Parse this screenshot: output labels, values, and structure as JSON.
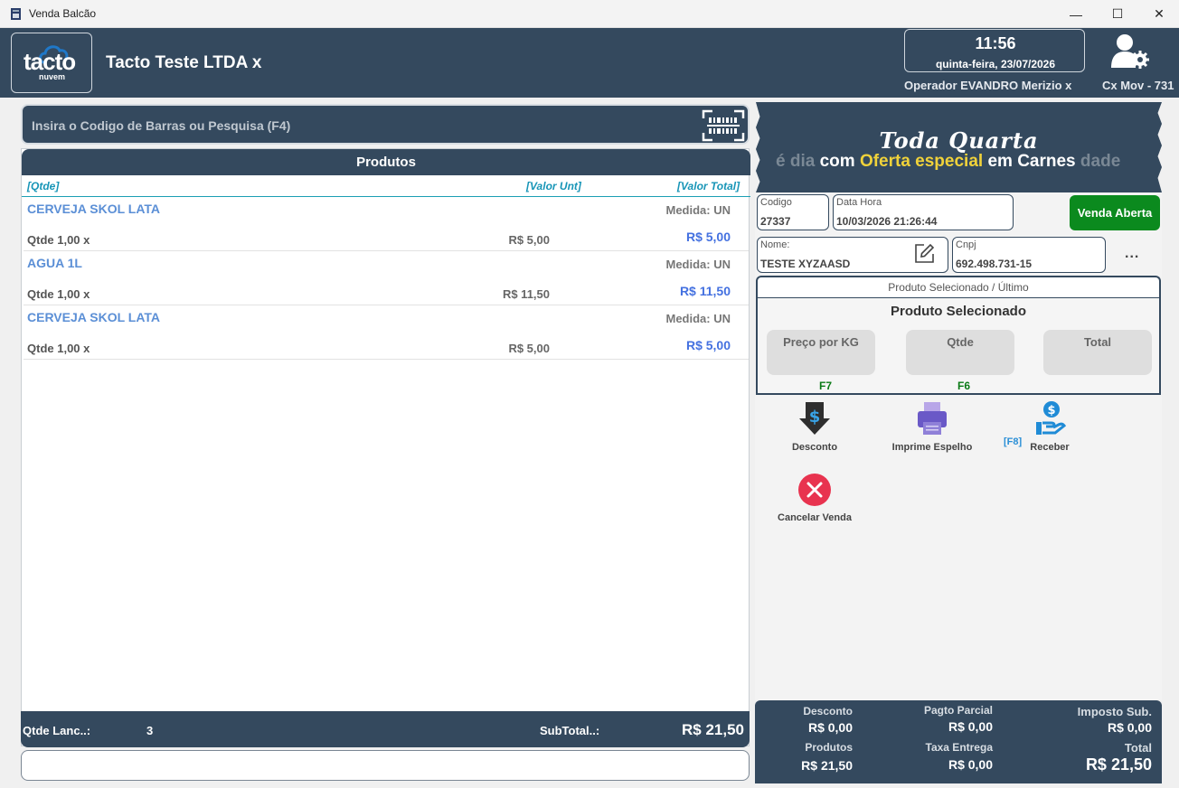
{
  "window": {
    "title": "Venda Balcão",
    "controls": {
      "minimize": "—",
      "maximize": "☐",
      "close": "✕"
    }
  },
  "header": {
    "logo_word": "tacto",
    "logo_sub": "nuvem",
    "company": "Tacto Teste LTDA x",
    "time": "11:56",
    "date": "quinta-feira, 23/07/2026",
    "operator": "Operador EVANDRO Merizio x",
    "cx_mov": "Cx Mov - 731"
  },
  "search": {
    "placeholder": "Insira o Codigo de Barras ou Pesquisa (F4)"
  },
  "products": {
    "title": "Produtos",
    "columns": {
      "qtde": "[Qtde]",
      "valor_unit": "[Valor Unt]",
      "valor_total": "[Valor Total]"
    },
    "items": [
      {
        "name": "CERVEJA  SKOL LATA",
        "medida": "Medida: UN",
        "qtde": "Qtde 1,00 x",
        "unit": "R$ 5,00",
        "total": "R$ 5,00"
      },
      {
        "name": "AGUA 1L",
        "medida": "Medida: UN",
        "qtde": "Qtde 1,00 x",
        "unit": "R$ 11,50",
        "total": "R$ 11,50"
      },
      {
        "name": "CERVEJA  SKOL LATA",
        "medida": "Medida: UN",
        "qtde": "Qtde 1,00 x",
        "unit": "R$ 5,00",
        "total": "R$ 5,00"
      }
    ]
  },
  "footer": {
    "qtde_label": "Qtde Lanc..:",
    "qtde_value": "3",
    "subtotal_label": "SubTotal..:",
    "subtotal_value": "R$ 21,50"
  },
  "banner": {
    "script_text": "Toda Quarta",
    "line_prefix": "é dia ",
    "line_com": "com ",
    "line_highlight": "Oferta especial",
    "line_em": " em Carnes",
    "line_suffix": " dade"
  },
  "sale": {
    "codigo_label": "Codigo",
    "codigo_value": "27337",
    "datahora_label": "Data Hora",
    "datahora_value": "10/03/2026 21:26:44",
    "status_button": "Venda Aberta",
    "nome_label": "Nome:",
    "nome_value": "TESTE XYZAASD",
    "cnpj_label": "Cnpj",
    "cnpj_value": "692.498.731-15",
    "more": "..."
  },
  "produto_selecionado": {
    "tab": "Produto Selecionado / Último",
    "title": "Produto Selecionado",
    "preco_label": "Preço por KG",
    "preco_key": "F7",
    "qtde_label": "Qtde",
    "qtde_key": "F6",
    "total_label": "Total"
  },
  "actions": {
    "desconto": "Desconto",
    "imprime": "Imprime Espelho",
    "receber_key": "[F8]",
    "receber": "Receber",
    "cancelar": "Cancelar Venda"
  },
  "totals": {
    "desconto_label": "Desconto",
    "desconto_value": "R$ 0,00",
    "pagto_label": "Pagto Parcial",
    "pagto_value": "R$ 0,00",
    "imposto_label": "Imposto Sub.",
    "imposto_value": "R$ 0,00",
    "produtos_label": "Produtos",
    "produtos_value": "R$ 21,50",
    "taxa_label": "Taxa Entrega",
    "taxa_value": "R$ 0,00",
    "total_label": "Total",
    "total_value": "R$ 21,50"
  },
  "colors": {
    "header_bg": "#34495e",
    "status_green": "#0b8a1e",
    "product_name": "#5b8fd6",
    "product_total": "#4471e0",
    "column_header": "#1795b7",
    "banner_highlight": "#f0d23a"
  }
}
